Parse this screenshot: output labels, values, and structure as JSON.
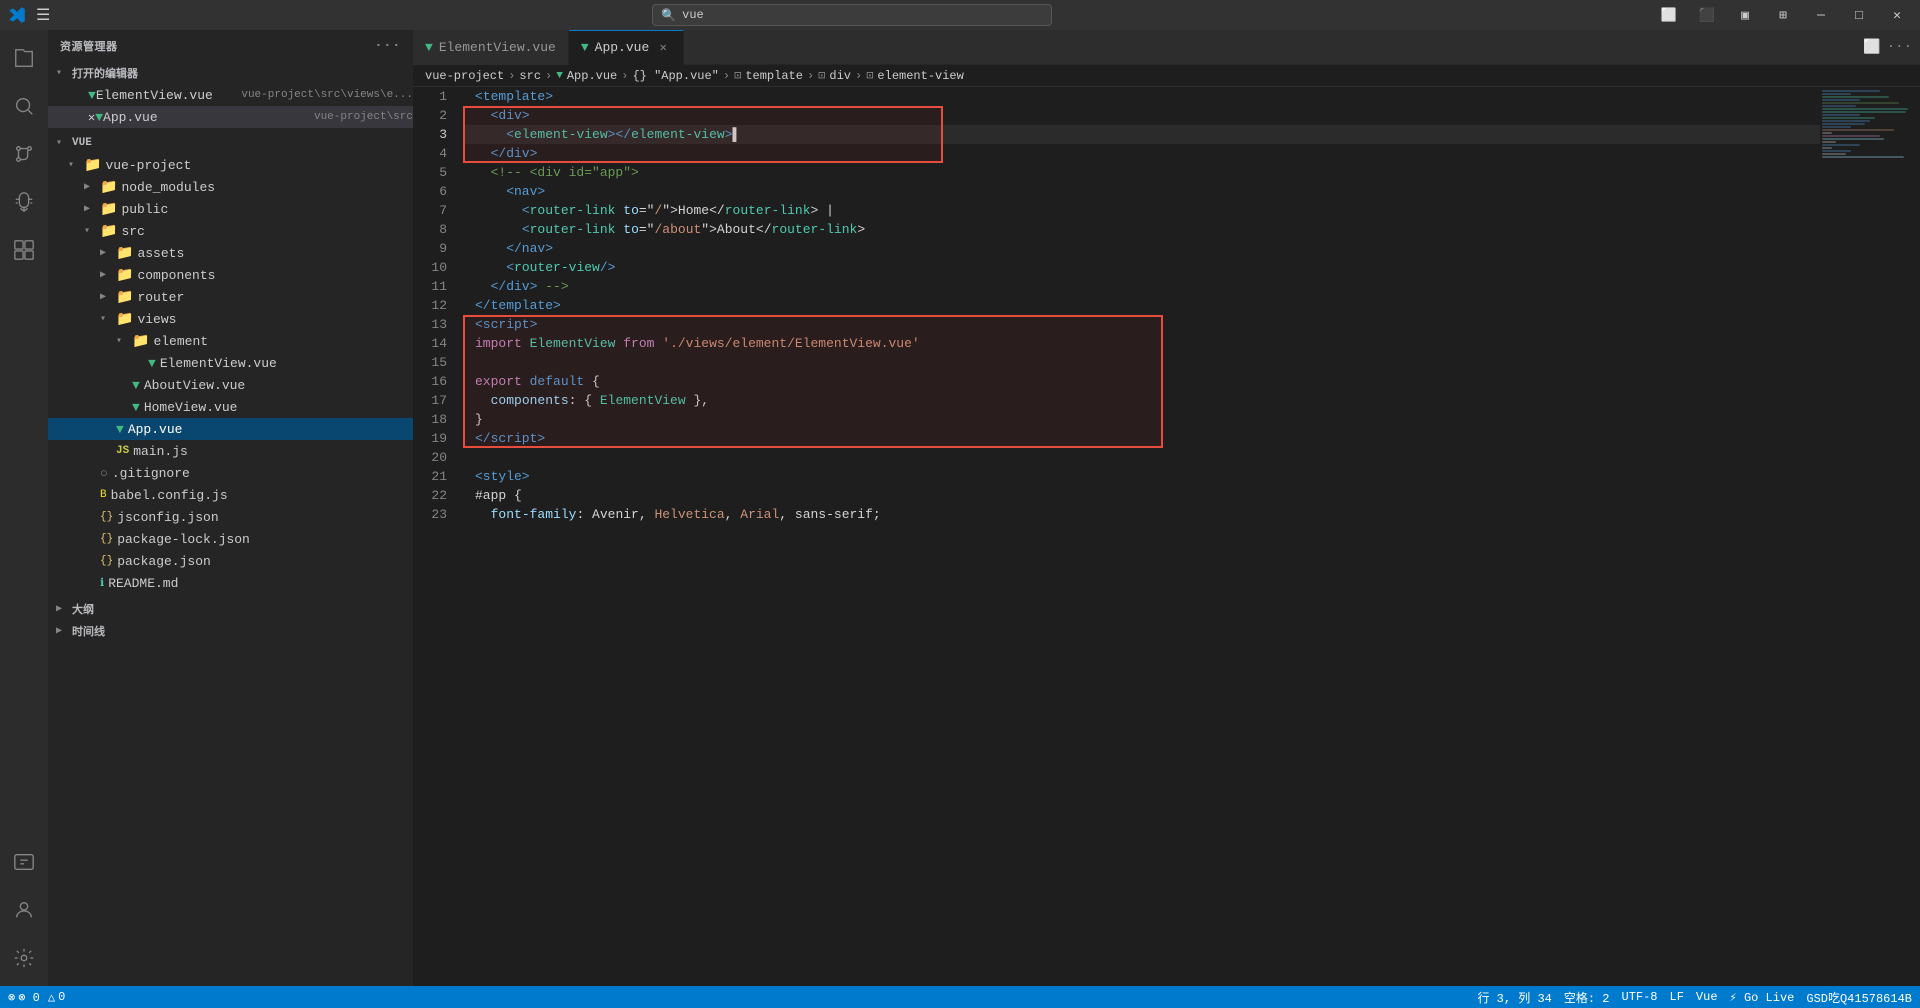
{
  "titlebar": {
    "search_placeholder": "vue",
    "min_label": "─",
    "max_label": "□",
    "close_label": "✕",
    "restore_label": "❐"
  },
  "sidebar": {
    "header_label": "资源管理器",
    "open_editors_label": "打开的编辑器",
    "vue_label": "VUE",
    "vue_project_label": "vue-project",
    "node_modules_label": "node_modules",
    "public_label": "public",
    "src_label": "src",
    "assets_label": "assets",
    "components_label": "components",
    "router_label": "router",
    "views_label": "views",
    "element_label": "element",
    "element_view_file": "ElementView.vue",
    "element_view_path": "vue-project\\src\\views\\e...",
    "app_vue_file": "App.vue",
    "app_vue_path": "vue-project\\src",
    "about_view": "AboutView.vue",
    "home_view": "HomeView.vue",
    "app_vue_tree": "App.vue",
    "main_js": "main.js",
    "gitignore": ".gitignore",
    "babel_config": "babel.config.js",
    "jsconfig": "jsconfig.json",
    "package_lock": "package-lock.json",
    "package": "package.json",
    "readme": "README.md",
    "outline_label": "大纲",
    "timeline_label": "时间线"
  },
  "tabs": {
    "element_view_tab": "ElementView.vue",
    "app_vue_tab": "App.vue"
  },
  "breadcrumb": {
    "project": "vue-project",
    "src": "src",
    "file": "App.vue",
    "script": "{} \"App.vue\"",
    "template": "template",
    "div": "div",
    "element_view": "element-view"
  },
  "editor": {
    "lines": [
      {
        "num": 1,
        "tokens": [
          {
            "t": "<",
            "c": "c-tag"
          },
          {
            "t": "template",
            "c": "c-tag"
          },
          {
            "t": ">",
            "c": "c-tag"
          }
        ]
      },
      {
        "num": 2,
        "tokens": [
          {
            "t": "  <",
            "c": "c-tag"
          },
          {
            "t": "div",
            "c": "c-tag"
          },
          {
            "t": ">",
            "c": "c-tag"
          }
        ]
      },
      {
        "num": 3,
        "tokens": [
          {
            "t": "    <",
            "c": "c-component"
          },
          {
            "t": "element-view",
            "c": "c-component"
          },
          {
            "t": "></",
            "c": "c-tag"
          },
          {
            "t": "element-view",
            "c": "c-component"
          },
          {
            "t": ">",
            "c": "c-tag"
          },
          {
            "t": "▌",
            "c": "c-white"
          }
        ]
      },
      {
        "num": 4,
        "tokens": [
          {
            "t": "  </",
            "c": "c-tag"
          },
          {
            "t": "div",
            "c": "c-tag"
          },
          {
            "t": ">",
            "c": "c-tag"
          }
        ]
      },
      {
        "num": 5,
        "tokens": [
          {
            "t": "  ",
            "c": "c-text"
          },
          {
            "t": "<!-- <div id=\"app\">",
            "c": "c-comment"
          }
        ]
      },
      {
        "num": 6,
        "tokens": [
          {
            "t": "    <",
            "c": "c-tag"
          },
          {
            "t": "nav",
            "c": "c-tag"
          },
          {
            "t": ">",
            "c": "c-tag"
          }
        ]
      },
      {
        "num": 7,
        "tokens": [
          {
            "t": "      <",
            "c": "c-component"
          },
          {
            "t": "router-link",
            "c": "c-component"
          },
          {
            "t": " ",
            "c": "c-text"
          },
          {
            "t": "to",
            "c": "c-attr"
          },
          {
            "t": "=\"",
            "c": "c-text"
          },
          {
            "t": "/",
            "c": "c-string"
          },
          {
            "t": "\"",
            "c": "c-text"
          },
          {
            "t": ">Home</",
            "c": "c-text"
          },
          {
            "t": "router-link",
            "c": "c-component"
          },
          {
            "t": "> |",
            "c": "c-text"
          }
        ]
      },
      {
        "num": 8,
        "tokens": [
          {
            "t": "      <",
            "c": "c-component"
          },
          {
            "t": "router-link",
            "c": "c-component"
          },
          {
            "t": " ",
            "c": "c-text"
          },
          {
            "t": "to",
            "c": "c-attr"
          },
          {
            "t": "=\"",
            "c": "c-text"
          },
          {
            "t": "/about",
            "c": "c-string"
          },
          {
            "t": "\"",
            "c": "c-text"
          },
          {
            "t": ">About</",
            "c": "c-text"
          },
          {
            "t": "router-link",
            "c": "c-component"
          },
          {
            "t": ">",
            "c": "c-text"
          }
        ]
      },
      {
        "num": 9,
        "tokens": [
          {
            "t": "    </",
            "c": "c-tag"
          },
          {
            "t": "nav",
            "c": "c-tag"
          },
          {
            "t": ">",
            "c": "c-tag"
          }
        ]
      },
      {
        "num": 10,
        "tokens": [
          {
            "t": "    <",
            "c": "c-component"
          },
          {
            "t": "router-view",
            "c": "c-component"
          },
          {
            "t": "/>",
            "c": "c-tag"
          }
        ]
      },
      {
        "num": 11,
        "tokens": [
          {
            "t": "  </",
            "c": "c-tag"
          },
          {
            "t": "div",
            "c": "c-tag"
          },
          {
            "t": "> -->",
            "c": "c-comment"
          }
        ]
      },
      {
        "num": 12,
        "tokens": [
          {
            "t": "</",
            "c": "c-tag"
          },
          {
            "t": "template",
            "c": "c-tag"
          },
          {
            "t": ">",
            "c": "c-tag"
          }
        ]
      },
      {
        "num": 13,
        "tokens": [
          {
            "t": "<",
            "c": "c-tag"
          },
          {
            "t": "script",
            "c": "c-tag"
          },
          {
            "t": ">",
            "c": "c-tag"
          }
        ]
      },
      {
        "num": 14,
        "tokens": [
          {
            "t": "import ",
            "c": "c-import"
          },
          {
            "t": "ElementView ",
            "c": "c-component"
          },
          {
            "t": "from ",
            "c": "c-from"
          },
          {
            "t": "'./views/element/ElementView.vue'",
            "c": "c-path"
          }
        ]
      },
      {
        "num": 15,
        "tokens": []
      },
      {
        "num": 16,
        "tokens": [
          {
            "t": "export ",
            "c": "c-export"
          },
          {
            "t": "default",
            "c": "c-default"
          },
          {
            "t": " {",
            "c": "c-text"
          }
        ]
      },
      {
        "num": 17,
        "tokens": [
          {
            "t": "  components: { ",
            "c": "c-prop"
          },
          {
            "t": "ElementView",
            "c": "c-component"
          },
          {
            "t": " },",
            "c": "c-text"
          }
        ]
      },
      {
        "num": 18,
        "tokens": [
          {
            "t": "}",
            "c": "c-text"
          }
        ]
      },
      {
        "num": 19,
        "tokens": [
          {
            "t": "</",
            "c": "c-tag"
          },
          {
            "t": "script",
            "c": "c-tag"
          },
          {
            "t": ">",
            "c": "c-tag"
          }
        ]
      },
      {
        "num": 20,
        "tokens": []
      },
      {
        "num": 21,
        "tokens": [
          {
            "t": "<",
            "c": "c-tag"
          },
          {
            "t": "style",
            "c": "c-tag"
          },
          {
            "t": ">",
            "c": "c-tag"
          }
        ]
      },
      {
        "num": 22,
        "tokens": [
          {
            "t": "#app {",
            "c": "c-text"
          }
        ]
      },
      {
        "num": 23,
        "tokens": [
          {
            "t": "  font-family: ",
            "c": "c-prop"
          },
          {
            "t": "Avenir, ",
            "c": "c-text"
          },
          {
            "t": "Helvetica, ",
            "c": "c-orange"
          },
          {
            "t": "Arial, ",
            "c": "c-orange"
          },
          {
            "t": "sans-serif;",
            "c": "c-text"
          }
        ]
      }
    ]
  },
  "statusbar": {
    "errors": "⊗ 0",
    "warnings": "△ 0",
    "line_col": "行 3, 列 34",
    "spaces": "空格: 2",
    "encoding": "UTF-8",
    "eol": "LF",
    "language": "Vue",
    "golive": "⚡ Go Live",
    "extra": "GSD吃Q41578614B"
  }
}
